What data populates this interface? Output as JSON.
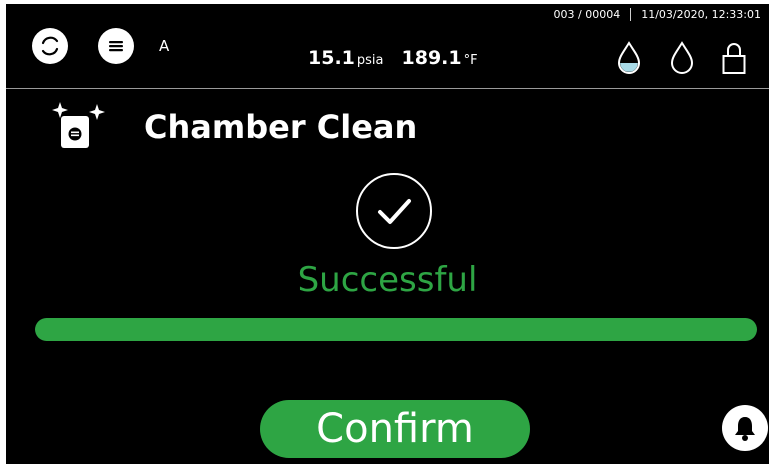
{
  "header": {
    "user_label": "A",
    "counter": "003 / 00004",
    "datetime": "11/03/2020, 12:33:01",
    "pressure": {
      "value": "15.1",
      "unit": "psia"
    },
    "temperature": {
      "value": "189.1",
      "unit": "°F"
    },
    "icons": [
      "refresh-icon",
      "menu-icon",
      "water-drop-filled-icon",
      "water-drop-outline-icon",
      "lock-icon"
    ]
  },
  "screen": {
    "icon": "chamber-clean-icon",
    "title": "Chamber Clean",
    "status_icon": "checkmark-circle-icon",
    "result": "Successful",
    "progress": 1.0
  },
  "footer": {
    "confirm_label": "Confirm",
    "bell_icon": "bell-icon"
  },
  "colors": {
    "background": "#000000",
    "accent_green": "#2ea544",
    "water_fill": "#a8dbe8",
    "text": "#ffffff"
  }
}
